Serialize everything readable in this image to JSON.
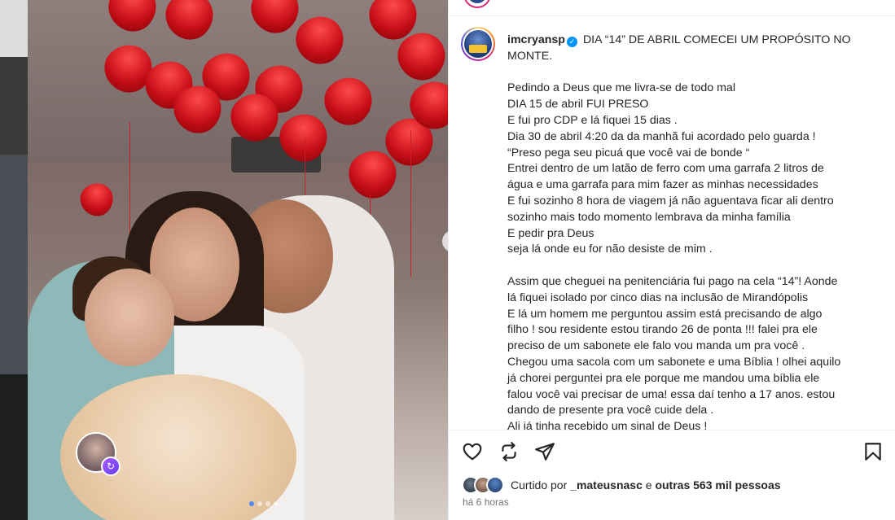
{
  "post": {
    "username": "imcryansp",
    "verified_mark": "✓",
    "caption_lines": [
      "DIA “14” DE ABRIL COMECEI UM PROPÓSITO NO",
      "MONTE.",
      "",
      "Pedindo a Deus que me livra-se de todo mal",
      "DIA 15 de abril FUI PRESO",
      "E fui pro CDP e lá fiquei 15 dias .",
      "Dia 30 de abril 4:20 da da manhã fui acordado pelo guarda !",
      "“Preso pega seu picuá que você vai de bonde “",
      "Entrei dentro de um latão de ferro com uma garrafa 2 litros de",
      "água e uma garrafa para mim fazer as minhas necessidades",
      "E fui sozinho 8 hora de viagem já não aguentava ficar ali dentro",
      "sozinho mais todo momento lembrava da minha família",
      "E pedir pra Deus",
      "seja lá onde eu for não desiste de mim .",
      "",
      "Assim que cheguei na penitenciária fui pago na cela “14”! Aonde",
      "lá fiquei isolado por cinco dias na inclusão de Mirandópolis",
      "E lá um homem me perguntou assim está precisando de algo",
      "filho ! sou residente estou tirando 26 de ponta !!! falei pra ele",
      "preciso de um sabonete ele falo vou manda um pra você .",
      "Chegou uma sacola com um sabonete e uma Bíblia ! olhei aquilo",
      "já chorei perguntei pra ele porque me mandou uma bíblia ele",
      "falou você vai precisar de uma! essa daí tenho a 17 anos. estou",
      "dando de presente pra você cuide dela .",
      "Ali já tinha recebido um sinal de Deus !"
    ],
    "liked_by_prefix": "Curtido por ",
    "liked_by_user": "_mateusnasc",
    "liked_by_middle": " e ",
    "liked_by_others": "outras 563 mil pessoas",
    "timestamp": "há 6 horas"
  },
  "carousel": {
    "next_icon": "chevron-right-icon",
    "total_dots": 4,
    "active_dot": 1
  },
  "icons": {
    "like": "heart-icon",
    "repost": "repost-icon",
    "share": "send-icon",
    "save": "bookmark-icon"
  },
  "colors": {
    "verified": "#0095f6",
    "text": "#262626",
    "muted": "#737373",
    "carousel_active_dot": "#4f8cf0"
  }
}
